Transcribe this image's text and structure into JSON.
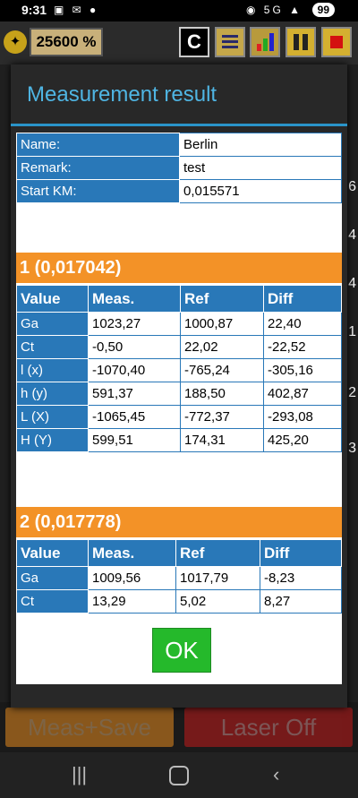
{
  "status_bar": {
    "time": "9:31",
    "battery": "99",
    "network": "5G"
  },
  "toolbar": {
    "counter": "25600 %",
    "c_button": "C"
  },
  "background": {
    "side_numbers": [
      "6",
      "4",
      "4",
      "1",
      "2",
      "3"
    ]
  },
  "bottom": {
    "meas_save": "Meas+Save",
    "laser_off": "Laser Off"
  },
  "dialog": {
    "title": "Measurement result",
    "info": [
      {
        "label": "Name:",
        "value": "Berlin"
      },
      {
        "label": "Remark:",
        "value": "test"
      },
      {
        "label": "Start KM:",
        "value": "0,015571"
      }
    ],
    "section1": {
      "title": "1 (0,017042)",
      "headers": [
        "Value",
        "Meas.",
        "Ref",
        "Diff"
      ],
      "rows": [
        [
          "Ga",
          "1023,27",
          "1000,87",
          "22,40"
        ],
        [
          "Ct",
          "-0,50",
          "22,02",
          "-22,52"
        ],
        [
          "l (x)",
          "-1070,40",
          "-765,24",
          "-305,16"
        ],
        [
          "h (y)",
          "591,37",
          "188,50",
          "402,87"
        ],
        [
          "L (X)",
          "-1065,45",
          "-772,37",
          "-293,08"
        ],
        [
          "H (Y)",
          "599,51",
          "174,31",
          "425,20"
        ]
      ]
    },
    "section2": {
      "title": "2 (0,017778)",
      "headers": [
        "Value",
        "Meas.",
        "Ref",
        "Diff"
      ],
      "rows": [
        [
          "Ga",
          "1009,56",
          "1017,79",
          "-8,23"
        ],
        [
          "Ct",
          "13,29",
          "5,02",
          "8,27"
        ]
      ]
    },
    "ok_label": "OK"
  }
}
